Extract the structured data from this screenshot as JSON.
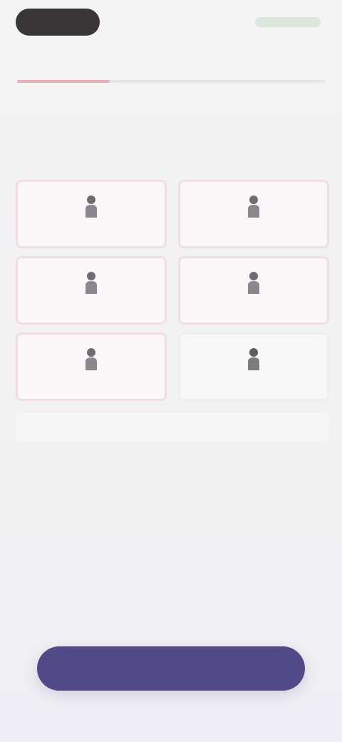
{
  "status_bar": {
    "right_label": ""
  },
  "header": {
    "title": ""
  },
  "progress": {
    "fraction": 0.3,
    "fill_color": "#e6aeb7"
  },
  "question": {
    "text": "",
    "subtitle": ""
  },
  "options": [
    {
      "label": "",
      "selected": true,
      "icon": "person-icon"
    },
    {
      "label": "",
      "selected": true,
      "icon": "person-icon"
    },
    {
      "label": "",
      "selected": true,
      "icon": "person-icon"
    },
    {
      "label": "",
      "selected": true,
      "icon": "person-icon"
    },
    {
      "label": "",
      "selected": true,
      "icon": "person-icon"
    },
    {
      "label": "",
      "selected": false,
      "icon": "person-icon"
    }
  ],
  "other_input": {
    "placeholder": "",
    "value": ""
  },
  "cta": {
    "label": "",
    "color": "#514a86"
  }
}
